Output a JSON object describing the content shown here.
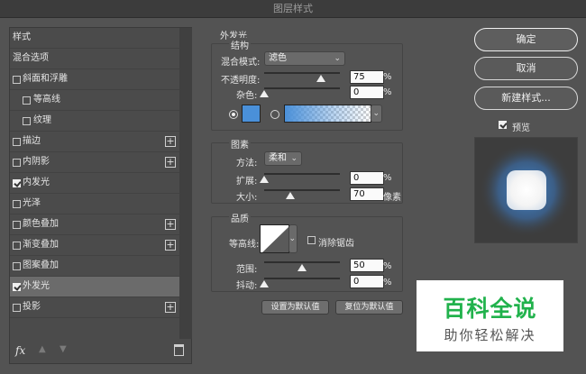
{
  "window": {
    "title": "图层样式"
  },
  "left_panel": {
    "items": [
      {
        "label": "样式",
        "type": "header",
        "checked": false,
        "plus": false
      },
      {
        "label": "混合选项",
        "type": "header",
        "checked": false,
        "plus": false
      },
      {
        "label": "斜面和浮雕",
        "type": "item",
        "checked": false,
        "plus": false
      },
      {
        "label": "等高线",
        "type": "sub",
        "checked": false,
        "plus": false
      },
      {
        "label": "纹理",
        "type": "sub",
        "checked": false,
        "plus": false
      },
      {
        "label": "描边",
        "type": "item",
        "checked": false,
        "plus": true
      },
      {
        "label": "内阴影",
        "type": "item",
        "checked": false,
        "plus": true
      },
      {
        "label": "内发光",
        "type": "item",
        "checked": true,
        "plus": false
      },
      {
        "label": "光泽",
        "type": "item",
        "checked": false,
        "plus": false
      },
      {
        "label": "颜色叠加",
        "type": "item",
        "checked": false,
        "plus": true
      },
      {
        "label": "渐变叠加",
        "type": "item",
        "checked": false,
        "plus": true
      },
      {
        "label": "图案叠加",
        "type": "item",
        "checked": false,
        "plus": false
      },
      {
        "label": "外发光",
        "type": "item",
        "checked": true,
        "plus": false,
        "selected": true
      },
      {
        "label": "投影",
        "type": "item",
        "checked": false,
        "plus": true
      }
    ],
    "footer": {
      "fx": "fx",
      "up_arrow": "▲",
      "down_arrow": "▼"
    }
  },
  "main": {
    "title": "外发光",
    "structure": {
      "title": "结构",
      "blend_mode_label": "混合模式:",
      "blend_mode_value": "滤色",
      "opacity_label": "不透明度:",
      "opacity_value": "75",
      "noise_label": "杂色:",
      "noise_value": "0",
      "percent": "%",
      "color_swatch": "#4a90d9"
    },
    "elements": {
      "title": "图素",
      "method_label": "方法:",
      "method_value": "柔和",
      "spread_label": "扩展:",
      "spread_value": "0",
      "size_label": "大小:",
      "size_value": "70",
      "size_unit": "像素",
      "percent": "%"
    },
    "quality": {
      "title": "品质",
      "contour_label": "等高线:",
      "antialias_label": "消除锯齿",
      "range_label": "范围:",
      "range_value": "50",
      "jitter_label": "抖动:",
      "jitter_value": "0",
      "percent": "%"
    },
    "buttons": {
      "set_default": "设置为默认值",
      "reset_default": "复位为默认值"
    }
  },
  "right_panel": {
    "ok": "确定",
    "cancel": "取消",
    "new_style": "新建样式...",
    "preview_label": "预览",
    "preview_checked": true
  },
  "watermark": {
    "line1": "百科全说",
    "line2": "助你轻松解决"
  }
}
